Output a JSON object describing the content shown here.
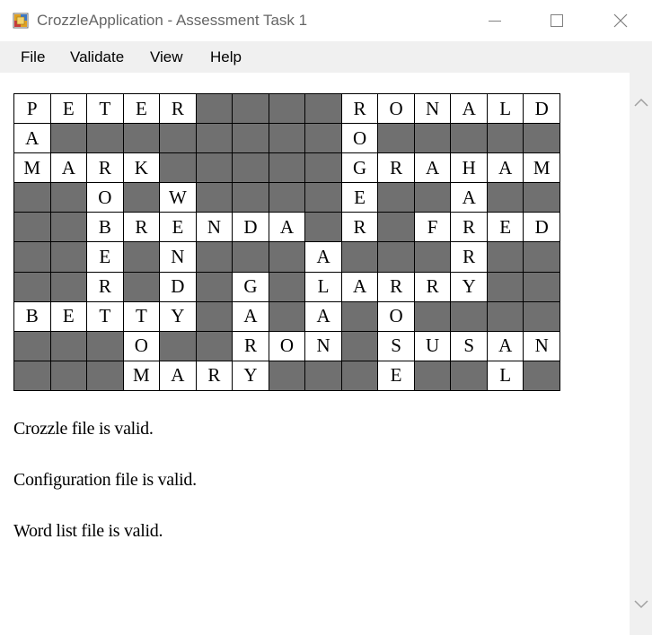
{
  "window": {
    "title": "CrozzleApplication - Assessment Task 1"
  },
  "menu": {
    "items": [
      "File",
      "Validate",
      "View",
      "Help"
    ]
  },
  "crozzle": {
    "rows": [
      "PETER####RONALD",
      "A########O#####",
      "MARK#####GRAHAM",
      "##O#W####E##A##",
      "##BRENDA#R#FRED",
      "##E#N###A###R##",
      "##R#D#G#LARRY##",
      "BETTY#A#A#O####",
      "###O##RON#SUSAN",
      "###MARY###E##L#"
    ]
  },
  "status": {
    "crozzle": "Crozzle file is valid.",
    "configuration": "Configuration file is valid.",
    "wordlist": "Word list file is valid."
  }
}
